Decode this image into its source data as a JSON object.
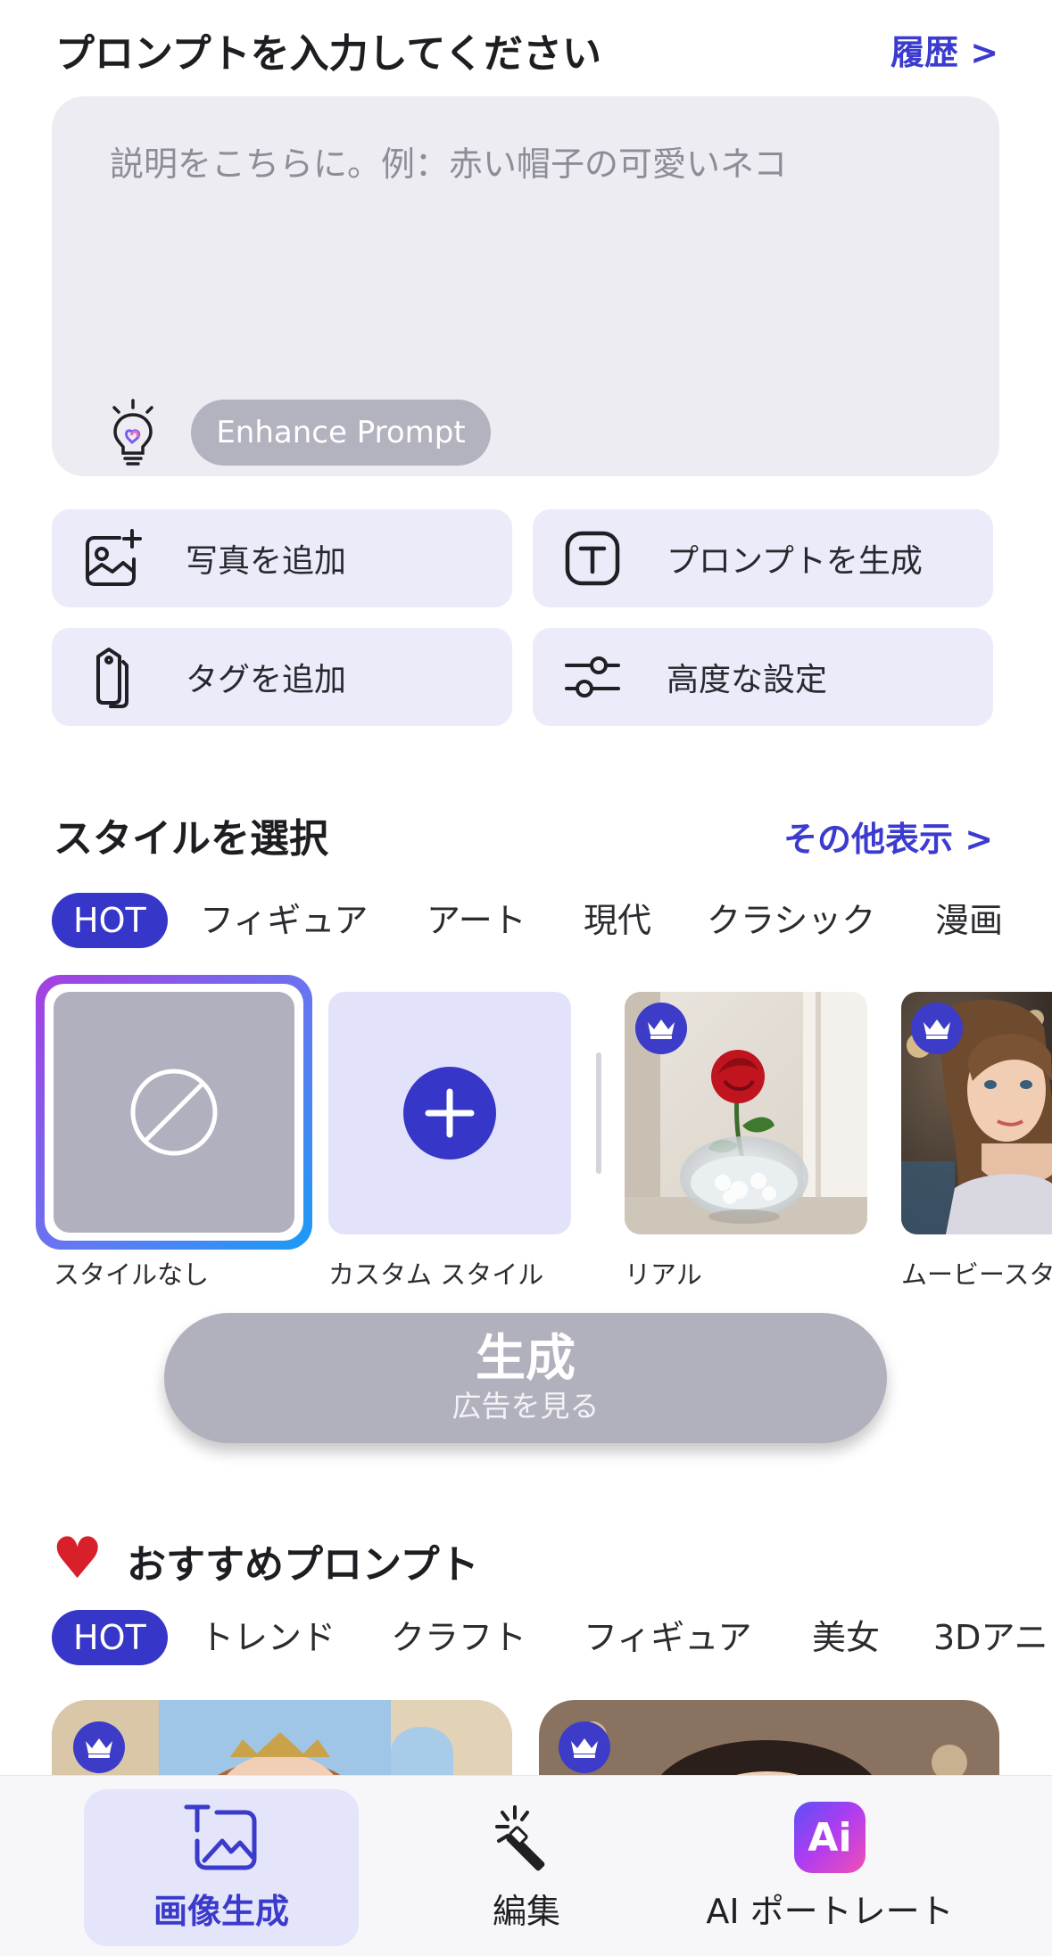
{
  "header": {
    "title": "プロンプトを入力してください",
    "history_link": "履歴 >"
  },
  "prompt": {
    "placeholder": "説明をこちらに。例：赤い帽子の可愛いネコ",
    "enhance_label": "Enhance Prompt"
  },
  "actions": [
    {
      "label": "写真を追加",
      "icon": "add-photo-icon"
    },
    {
      "label": "プロンプトを生成",
      "icon": "text-t-icon"
    },
    {
      "label": "タグを追加",
      "icon": "tag-icon"
    },
    {
      "label": "高度な設定",
      "icon": "sliders-icon"
    }
  ],
  "styles": {
    "title": "スタイルを選択",
    "more_link": "その他表示 >",
    "categories": [
      "HOT",
      "フィギュア",
      "アート",
      "現代",
      "クラシック",
      "漫画"
    ],
    "active_category": "HOT",
    "items": [
      {
        "label": "スタイルなし",
        "icon": "no-style-icon",
        "selected": true
      },
      {
        "label": "カスタム スタイル",
        "icon": "plus-circle-icon"
      },
      {
        "label": "リアル",
        "icon": "rose-vase-image",
        "premium": true
      },
      {
        "label": "ムービースター",
        "icon": "woman-portrait-image",
        "premium": true
      }
    ]
  },
  "generate": {
    "label": "生成",
    "sublabel": "広告を見る"
  },
  "recommended": {
    "heart": "♥",
    "title": "おすすめプロンプト",
    "categories": [
      "HOT",
      "トレンド",
      "クラフト",
      "フィギュア",
      "美女",
      "3Dアニ"
    ],
    "active_category": "HOT"
  },
  "tabbar": {
    "tabs": [
      {
        "label": "画像生成",
        "icon": "image-generate-icon",
        "active": true
      },
      {
        "label": "編集",
        "icon": "magic-wand-icon"
      },
      {
        "label": "AI ポートレート",
        "icon": "ai-logo-icon"
      }
    ],
    "ai_logo_text": "Ai"
  },
  "colors": {
    "accent": "#3b3bd0",
    "chip_active": "#3636c8",
    "disabled": "#b1b0bd",
    "card_bg": "#ebebfa"
  }
}
